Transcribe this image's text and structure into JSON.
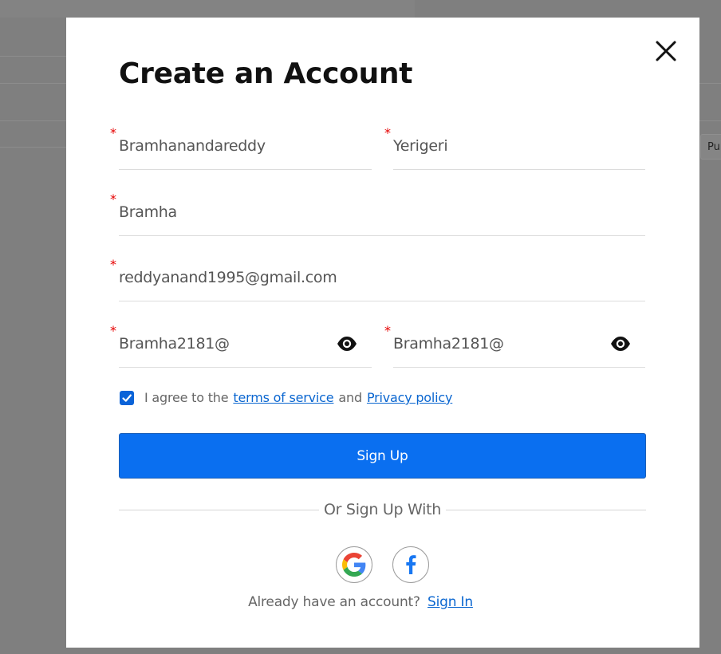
{
  "background": {
    "partial_button_label": "Pu"
  },
  "modal": {
    "title": "Create an Account",
    "close_icon": "close-icon",
    "fields": {
      "first_name": {
        "value": "Bramhanandareddy",
        "required_mark": "*"
      },
      "last_name": {
        "value": "Yerigeri",
        "required_mark": "*"
      },
      "username": {
        "value": "Bramha",
        "required_mark": "*"
      },
      "email": {
        "value": "reddyanand1995@gmail.com",
        "required_mark": "*"
      },
      "password": {
        "value": "Bramha2181@",
        "required_mark": "*",
        "icon": "eye-icon"
      },
      "confirm_password": {
        "value": "Bramha2181@",
        "required_mark": "*",
        "icon": "eye-icon"
      }
    },
    "agree": {
      "checked": true,
      "prefix": "I agree to the",
      "terms_link": "terms of service",
      "conjunction": "and",
      "privacy_link": "Privacy policy"
    },
    "signup_button": "Sign Up",
    "divider_text": "Or Sign Up With",
    "social": {
      "google_icon": "google-icon",
      "facebook_icon": "facebook-icon"
    },
    "signin": {
      "prompt": "Already have an account?",
      "link": "Sign In"
    }
  },
  "colors": {
    "primary": "#0a6ff0",
    "link": "#0a66d0",
    "required": "#e60000",
    "overlay": "#7f7f7f"
  }
}
